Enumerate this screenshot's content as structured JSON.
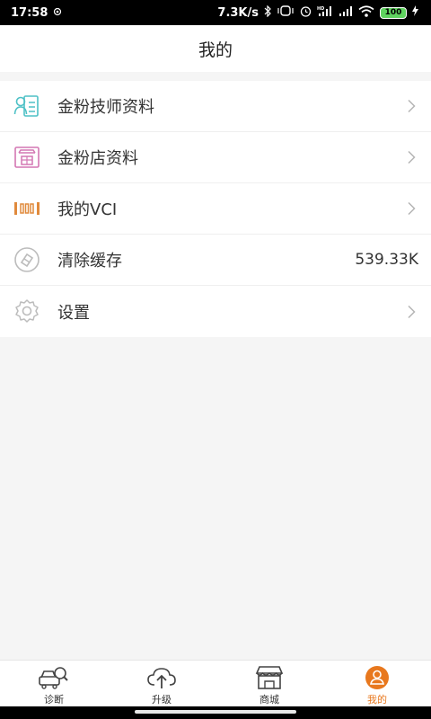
{
  "status_bar": {
    "time": "17:58",
    "net_speed": "7.3K/s",
    "hd_label": "HD",
    "battery": "100"
  },
  "header": {
    "title": "我的"
  },
  "menu": {
    "items": [
      {
        "label": "金粉技师资料",
        "icon": "technician-card-icon",
        "color": "#4ec1c6"
      },
      {
        "label": "金粉店资料",
        "icon": "store-icon",
        "color": "#d377b3"
      },
      {
        "label": "我的VCI",
        "icon": "vci-device-icon",
        "color": "#e08a3c"
      },
      {
        "label": "清除缓存",
        "icon": "clear-cache-icon",
        "value": "539.33K",
        "color": "#b9b9b9"
      },
      {
        "label": "设置",
        "icon": "gear-icon",
        "color": "#b9b9b9"
      }
    ]
  },
  "bottom_nav": {
    "items": [
      {
        "label": "诊断",
        "icon": "car-search-icon",
        "active": false
      },
      {
        "label": "升级",
        "icon": "cloud-upgrade-icon",
        "active": false
      },
      {
        "label": "商城",
        "icon": "shop-icon",
        "active": false
      },
      {
        "label": "我的",
        "icon": "user-icon",
        "active": true
      }
    ],
    "active_color": "#e8781e"
  }
}
